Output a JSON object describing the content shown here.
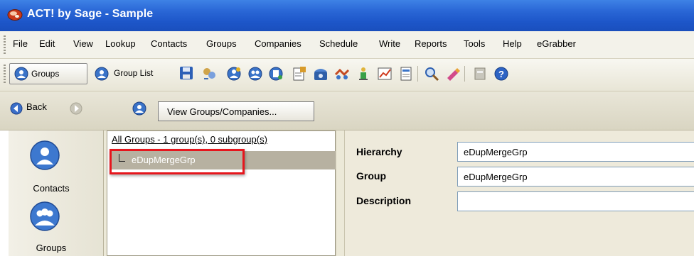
{
  "window": {
    "title": "ACT! by Sage - Sample"
  },
  "menu": [
    "File",
    "Edit",
    "View",
    "Lookup",
    "Contacts",
    "Groups",
    "Companies",
    "Schedule",
    "Write",
    "Reports",
    "Tools",
    "Help",
    "eGrabber"
  ],
  "toolbar": {
    "groups_label": "Groups",
    "group_list_label": "Group List"
  },
  "nav": {
    "back_label": "Back",
    "view_button_label": "View Groups/Companies..."
  },
  "sidebar": {
    "contacts_label": "Contacts",
    "groups_label": "Groups"
  },
  "tree": {
    "root_label": "All Groups - 1 group(s), 0 subgroup(s)",
    "selected_item": "eDupMergeGrp"
  },
  "details": {
    "hierarchy_label": "Hierarchy",
    "hierarchy_value": "eDupMergeGrp",
    "group_label": "Group",
    "group_value": "eDupMergeGrp",
    "description_label": "Description",
    "description_value": ""
  },
  "colors": {
    "title_bar": "#2a67d6",
    "highlight_border": "#e6161d",
    "selection": "#b7b1a1",
    "detail_bg": "#eeeadb"
  }
}
